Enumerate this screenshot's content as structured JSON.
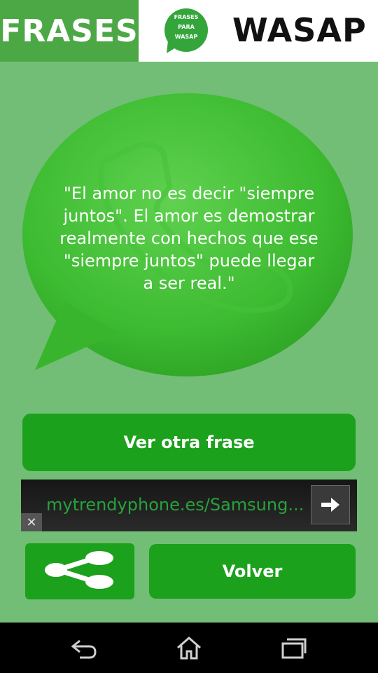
{
  "header": {
    "left_title": "FRASES",
    "right_title": "WASAP",
    "logo_lines": [
      "FRASES",
      "PARA",
      "WASAP"
    ]
  },
  "quote": "\"El amor no es decir \"siempre juntos\". El amor es demostrar realmente con hechos que ese \"siempre juntos\" puede llegar a ser real.\"",
  "buttons": {
    "next_phrase": "Ver otra frase",
    "back": "Volver"
  },
  "ad": {
    "text": "mytrendyphone.es/Samsung..."
  },
  "icons": {
    "share": "share-icon",
    "ad_arrow": "arrow-right-icon",
    "ad_close": "close-icon",
    "nav_back": "back-icon",
    "nav_home": "home-icon",
    "nav_recents": "recents-icon"
  },
  "colors": {
    "background": "#72be76",
    "header_green": "#4ca845",
    "button_green": "#1ba11b",
    "ad_text": "#26a33a"
  }
}
